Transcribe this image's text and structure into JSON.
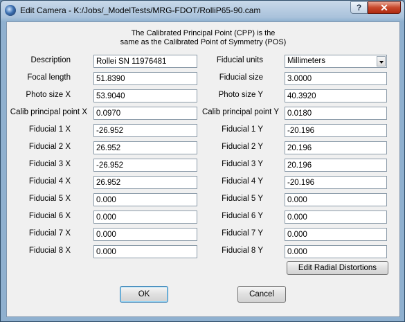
{
  "window": {
    "title": "Edit Camera - K:/Jobs/_ModelTests/MRG-FDOT/RolliP65-90.cam",
    "help_label": "?",
    "close_label": "✕"
  },
  "note": {
    "line1": "The Calibrated Principal Point (CPP) is the",
    "line2": "same as the Calibrated Point of Symmetry (POS)"
  },
  "left": {
    "description": {
      "label": "Description",
      "value": "Rollei SN 11976481"
    },
    "focal_length": {
      "label": "Focal length",
      "value": "51.8390"
    },
    "photo_size_x": {
      "label": "Photo size X",
      "value": "53.9040"
    },
    "calib_pp_x": {
      "label": "Calib principal point X",
      "value": "0.0970"
    },
    "fiducials": [
      {
        "label": "Fiducial 1 X",
        "value": "-26.952"
      },
      {
        "label": "Fiducial 2 X",
        "value": "26.952"
      },
      {
        "label": "Fiducial 3 X",
        "value": "-26.952"
      },
      {
        "label": "Fiducial 4 X",
        "value": "26.952"
      },
      {
        "label": "Fiducial 5 X",
        "value": "0.000"
      },
      {
        "label": "Fiducial 6 X",
        "value": "0.000"
      },
      {
        "label": "Fiducial 7 X",
        "value": "0.000"
      },
      {
        "label": "Fiducial 8 X",
        "value": "0.000"
      }
    ]
  },
  "right": {
    "fiducial_units": {
      "label": "Fiducial units",
      "value": "Millimeters"
    },
    "fiducial_size": {
      "label": "Fiducial size",
      "value": "3.0000"
    },
    "photo_size_y": {
      "label": "Photo size Y",
      "value": "40.3920"
    },
    "calib_pp_y": {
      "label": "Calib principal point Y",
      "value": "0.0180"
    },
    "fiducials": [
      {
        "label": "Fiducial 1 Y",
        "value": "-20.196"
      },
      {
        "label": "Fiducial 2 Y",
        "value": "20.196"
      },
      {
        "label": "Fiducial 3 Y",
        "value": "20.196"
      },
      {
        "label": "Fiducial 4 Y",
        "value": "-20.196"
      },
      {
        "label": "Fiducial 5 Y",
        "value": "0.000"
      },
      {
        "label": "Fiducial 6 Y",
        "value": "0.000"
      },
      {
        "label": "Fiducial 7 Y",
        "value": "0.000"
      },
      {
        "label": "Fiducial 8 Y",
        "value": "0.000"
      }
    ]
  },
  "buttons": {
    "edit_radial": "Edit Radial Distortions",
    "ok": "OK",
    "cancel": "Cancel"
  }
}
